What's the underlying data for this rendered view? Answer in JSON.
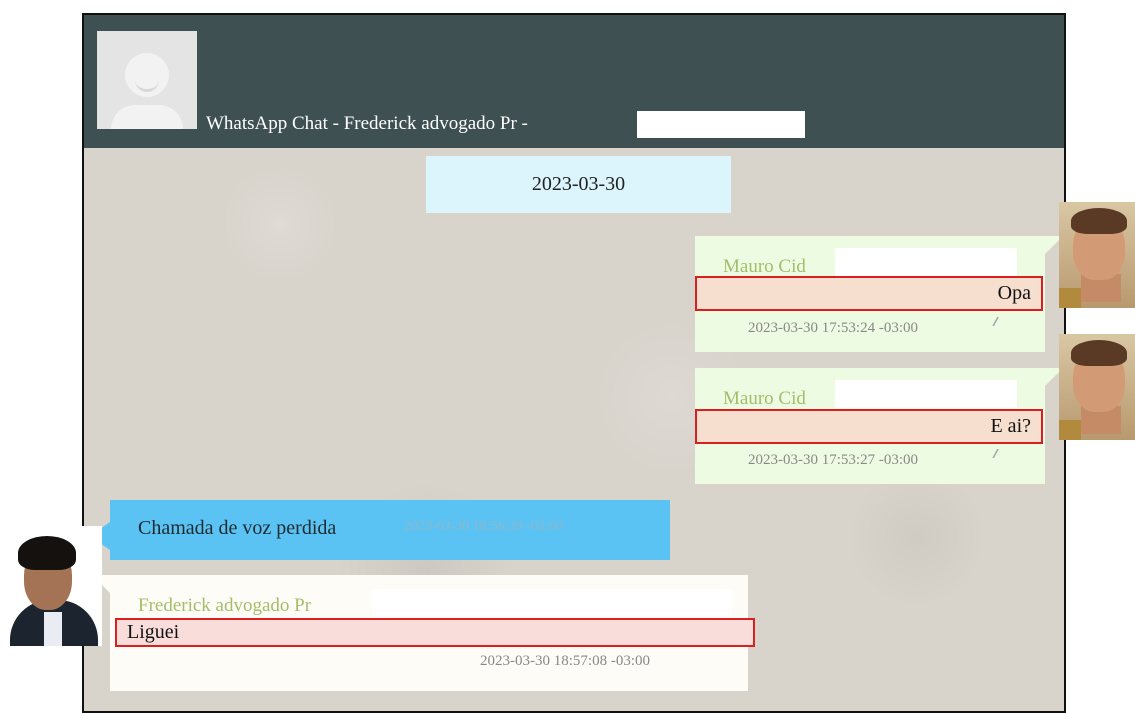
{
  "header": {
    "title": "WhatsApp Chat - Frederick advogado Pr -",
    "avatar_icon": "default-user-avatar-icon"
  },
  "date_separator": "2023-03-30",
  "messages": [
    {
      "direction": "outgoing",
      "sender": "Mauro Cid",
      "text": "Opa",
      "timestamp": "2023-03-30 17:53:24 -03:00",
      "status_icon": "double-check-icon"
    },
    {
      "direction": "outgoing",
      "sender": "Mauro Cid",
      "text": "E ai?",
      "timestamp": "2023-03-30 17:53:27 -03:00",
      "status_icon": "double-check-icon"
    },
    {
      "direction": "incoming",
      "type": "missed-call",
      "text": "Chamada de voz perdida",
      "timestamp": "2023-03-30 18:56:39 -03:00"
    },
    {
      "direction": "incoming",
      "sender": "Frederick advogado Pr",
      "text": "Liguei",
      "timestamp": "2023-03-30 18:57:08 -03:00"
    }
  ],
  "colors": {
    "header_bg": "#3f5052",
    "chat_bg": "#d8d3cb",
    "outgoing_bubble": "#eefbe3",
    "incoming_bubble": "#fefcf6",
    "missed_call_bubble": "#5bc3f3",
    "date_bubble": "#dcf5fd",
    "sender_name": "#a3be6a",
    "highlight_border": "#d91f1f"
  }
}
